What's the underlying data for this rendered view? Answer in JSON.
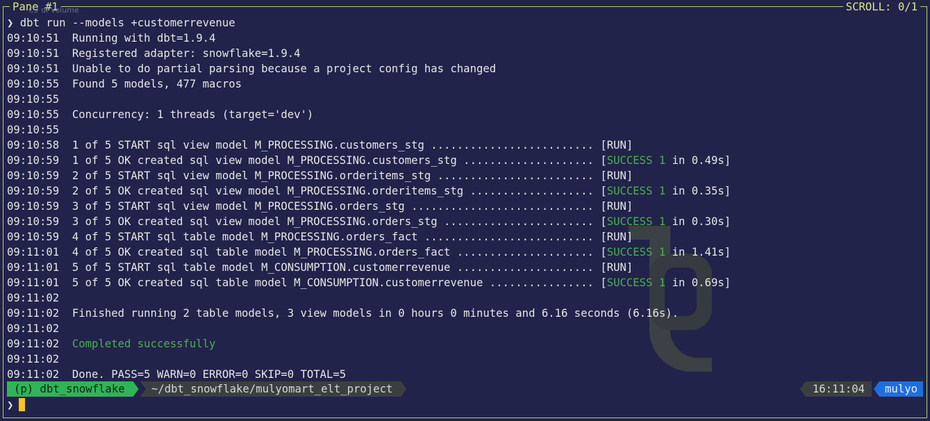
{
  "pane": {
    "title": "Pane #1",
    "ghost_title": "C3 di  Volume",
    "scroll_label": "SCROLL:  0/1"
  },
  "prompt_symbol": "❯",
  "command": "dbt run --models +customerrevenue",
  "log": [
    {
      "time": "09:10:51",
      "text": "Running with dbt=1.9.4"
    },
    {
      "time": "09:10:51",
      "text": "Registered adapter: snowflake=1.9.4"
    },
    {
      "time": "09:10:51",
      "text": "Unable to do partial parsing because a project config has changed"
    },
    {
      "time": "09:10:55",
      "text": "Found 5 models, 477 macros"
    },
    {
      "time": "09:10:55",
      "text": ""
    },
    {
      "time": "09:10:55",
      "text": "Concurrency: 1 threads (target='dev')"
    },
    {
      "time": "09:10:55",
      "text": ""
    },
    {
      "time": "09:10:58",
      "text": "1 of 5 START sql view model M_PROCESSING.customers_stg ......................... ",
      "tag": "[RUN]"
    },
    {
      "time": "09:10:59",
      "text": "1 of 5 OK created sql view model M_PROCESSING.customers_stg .................... ",
      "ok": "SUCCESS 1",
      "dur": " in 0.49s]"
    },
    {
      "time": "09:10:59",
      "text": "2 of 5 START sql view model M_PROCESSING.orderitems_stg ........................ ",
      "tag": "[RUN]"
    },
    {
      "time": "09:10:59",
      "text": "2 of 5 OK created sql view model M_PROCESSING.orderitems_stg ................... ",
      "ok": "SUCCESS 1",
      "dur": " in 0.35s]"
    },
    {
      "time": "09:10:59",
      "text": "3 of 5 START sql view model M_PROCESSING.orders_stg ............................ ",
      "tag": "[RUN]"
    },
    {
      "time": "09:10:59",
      "text": "3 of 5 OK created sql view model M_PROCESSING.orders_stg ....................... ",
      "ok": "SUCCESS 1",
      "dur": " in 0.30s]"
    },
    {
      "time": "09:10:59",
      "text": "4 of 5 START sql table model M_PROCESSING.orders_fact .......................... ",
      "tag": "[RUN]"
    },
    {
      "time": "09:11:01",
      "text": "4 of 5 OK created sql table model M_PROCESSING.orders_fact ..................... ",
      "ok": "SUCCESS 1",
      "dur": " in 1.41s]"
    },
    {
      "time": "09:11:01",
      "text": "5 of 5 START sql table model M_CONSUMPTION.customerrevenue ..................... ",
      "tag": "[RUN]"
    },
    {
      "time": "09:11:01",
      "text": "5 of 5 OK created sql table model M_CONSUMPTION.customerrevenue ................ ",
      "ok": "SUCCESS 1",
      "dur": " in 0.69s]"
    },
    {
      "time": "09:11:02",
      "text": ""
    },
    {
      "time": "09:11:02",
      "text": "Finished running 2 table models, 3 view models in 0 hours 0 minutes and 6.16 seconds (6.16s)."
    },
    {
      "time": "09:11:02",
      "text": ""
    },
    {
      "time": "09:11:02",
      "text": "Completed successfully",
      "green": true
    },
    {
      "time": "09:11:02",
      "text": ""
    },
    {
      "time": "09:11:02",
      "text": "Done. PASS=5 WARN=0 ERROR=0 SKIP=0 TOTAL=5"
    }
  ],
  "statusbar": {
    "env": "(p) dbt_snowflake",
    "path": "~/dbt_snowflake/mulyomart_elt_project",
    "time": "16:11:04",
    "user": "mulyo"
  },
  "colors": {
    "success": "#4caf50",
    "border": "#b3d36b",
    "cursor": "#f5c518",
    "user_badge": "#1f6ee0",
    "env_badge": "#2fb457"
  }
}
